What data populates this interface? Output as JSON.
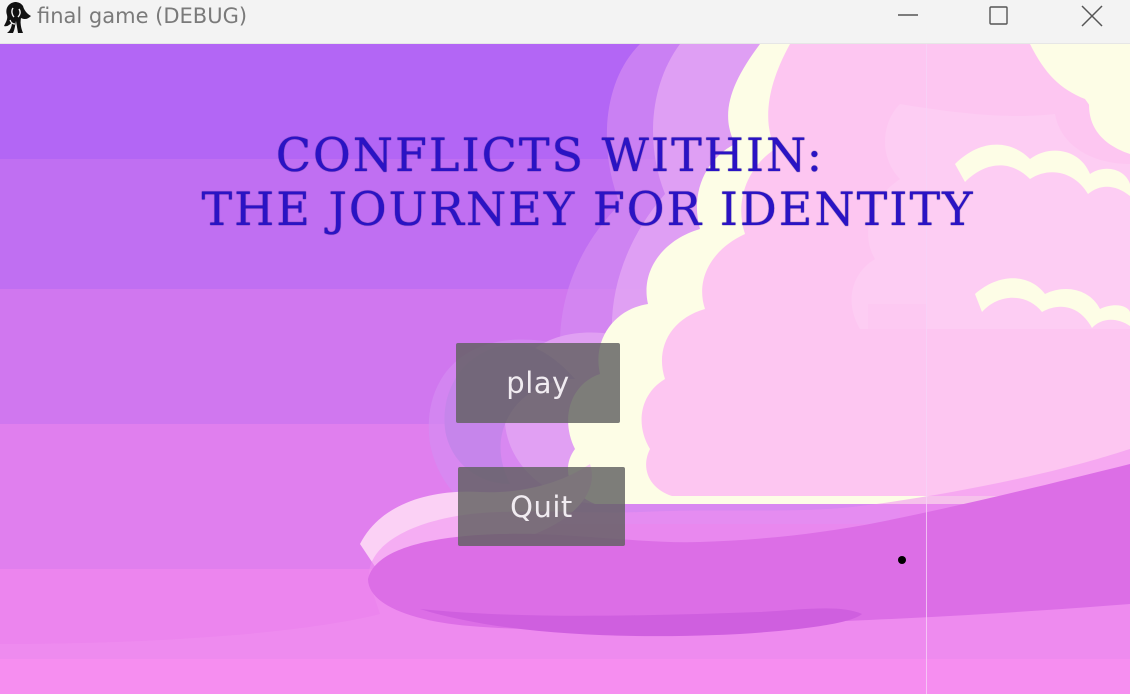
{
  "window": {
    "title": "final game (DEBUG)",
    "icons": [
      "app-icon",
      "minimize-icon",
      "maximize-icon",
      "close-icon"
    ]
  },
  "game": {
    "title_line1": "CONFLICTS WITHIN:",
    "title_line2": "THE JOURNEY FOR IDENTITY",
    "title_color": "#2a13c4",
    "buttons": {
      "play_label": "play",
      "quit_label": "Quit"
    },
    "colors": {
      "sky_top": "#b366f5",
      "sky_bottom": "#f18af0",
      "cloud_pink": "#fdc6f1",
      "cloud_highlight": "#fefde8",
      "ground": "#dc6ee6"
    }
  }
}
